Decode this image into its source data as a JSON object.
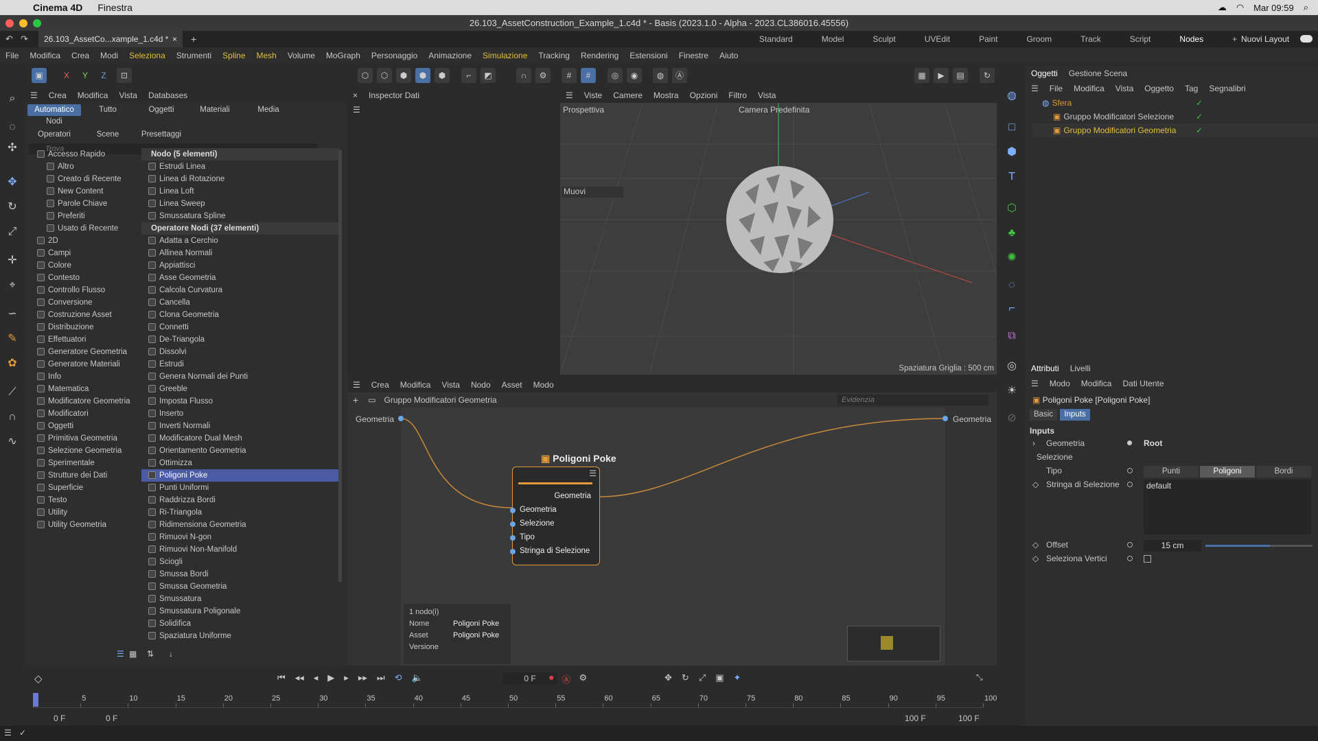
{
  "mac": {
    "app": "Cinema 4D",
    "menu1": "Finestra",
    "clock": "Mar 09:59"
  },
  "window": {
    "title": "26.103_AssetConstruction_Example_1.c4d * - Basis (2023.1.0 - Alpha - 2023.CL386016.45556)"
  },
  "doc_tab": {
    "label": "26.103_AssetCo...xample_1.c4d *",
    "close": "×",
    "add": "+"
  },
  "layouts": [
    "Standard",
    "Model",
    "Sculpt",
    "UVEdit",
    "Paint",
    "Groom",
    "Track",
    "Script",
    "Nodes",
    "+"
  ],
  "layout_new": "Nuovi Layout",
  "menu": [
    "File",
    "Modifica",
    "Crea",
    "Modi",
    "Seleziona",
    "Strumenti",
    "Spline",
    "Mesh",
    "Volume",
    "MoGraph",
    "Personaggio",
    "Animazione",
    "Simulazione",
    "Tracking",
    "Rendering",
    "Estensioni",
    "Finestre",
    "Aiuto"
  ],
  "axis": {
    "x": "X",
    "y": "Y",
    "z": "Z"
  },
  "asset_panel": {
    "header": [
      "Crea",
      "Modifica",
      "Vista",
      "Databases"
    ],
    "tabs_row1": [
      "Automatico",
      "Tutto",
      "Oggetti",
      "Materiali",
      "Media",
      "Nodi"
    ],
    "tabs_row2": [
      "Operatori",
      "Scene",
      "Presettaggi"
    ],
    "search_placeholder": "Trova",
    "tree": [
      "Accesso Rapido",
      "Altro",
      "Creato di Recente",
      "New Content",
      "Parole Chiave",
      "Preferiti",
      "Usato di Recente",
      "2D",
      "Campi",
      "Colore",
      "Contesto",
      "Controllo Flusso",
      "Conversione",
      "Costruzione Asset",
      "Distribuzione",
      "Effettuatori",
      "Generatore Geometria",
      "Generatore Materiali",
      "Info",
      "Matematica",
      "Modificatore Geometria",
      "Modificatori",
      "Oggetti",
      "Primitiva Geometria",
      "Selezione Geometria",
      "Sperimentale",
      "Strutture dei Dati",
      "Superficie",
      "Testo",
      "Utility",
      "Utility Geometria"
    ],
    "group1": "Nodo (5 elementi)",
    "group1_items": [
      "Estrudi Linea",
      "Linea di Rotazione",
      "Linea Loft",
      "Linea Sweep",
      "Smussatura Spline"
    ],
    "group2": "Operatore Nodi (37 elementi)",
    "group2_items": [
      "Adatta a Cerchio",
      "Allinea Normali",
      "Appiattisci",
      "Asse Geometria",
      "Calcola Curvatura",
      "Cancella",
      "Clona Geometria",
      "Connetti",
      "De-Triangola",
      "Dissolvi",
      "Estrudi",
      "Genera Normali dei Punti",
      "Greeble",
      "Imposta Flusso",
      "Inserto",
      "Inverti Normali",
      "Modificatore Dual Mesh",
      "Orientamento Geometria",
      "Ottimizza",
      "Poligoni Poke",
      "Punti Uniformi",
      "Raddrizza Bordi",
      "Ri-Triangola",
      "Ridimensiona Geometria",
      "Rimuovi N-gon",
      "Rimuovi Non-Manifold",
      "Sciogli",
      "Smussa Bordi",
      "Smussa Geometria",
      "Smussatura",
      "Smussatura Poligonale",
      "Solidifica",
      "Spaziatura Uniforme"
    ]
  },
  "inspector": {
    "title": "Inspector Dati"
  },
  "viewport": {
    "menu": [
      "Viste",
      "Camere",
      "Mostra",
      "Opzioni",
      "Filtro",
      "Vista"
    ],
    "view_name": "Prospettiva",
    "camera": "Camera Predefinita",
    "tool": "Muovi",
    "grid": "Spaziatura Griglia : 500 cm"
  },
  "node_editor": {
    "menu": [
      "Crea",
      "Modifica",
      "Vista",
      "Nodo",
      "Asset",
      "Modo"
    ],
    "breadcrumb": "Gruppo Modificatori Geometria",
    "search_placeholder": "Evidenzia",
    "left_port": "Geometria",
    "right_port": "Geometria",
    "node_title": "Poligoni Poke",
    "node_out": "Geometria",
    "node_inputs": [
      "Geometria",
      "Selezione",
      "Tipo",
      "Stringa di Selezione"
    ],
    "info": {
      "count": "1 nodo(i)",
      "name_k": "Nome",
      "name_v": "Poligoni Poke",
      "asset_k": "Asset",
      "asset_v": "Poligoni Poke",
      "ver_k": "Versione"
    }
  },
  "timeline": {
    "frame": "0 F",
    "ticks": [
      "0",
      "5",
      "10",
      "15",
      "20",
      "25",
      "30",
      "35",
      "40",
      "45",
      "50",
      "55",
      "60",
      "65",
      "70",
      "75",
      "80",
      "85",
      "90",
      "95",
      "100"
    ],
    "start": "0 F",
    "start2": "0 F",
    "end": "100 F",
    "end2": "100 F"
  },
  "objects": {
    "tabs": [
      "Oggetti",
      "Gestione Scena"
    ],
    "menu": [
      "File",
      "Modifica",
      "Vista",
      "Oggetto",
      "Tag",
      "Segnalibri"
    ],
    "items": [
      "Sfera",
      "Gruppo Modificatori Selezione",
      "Gruppo Modificatori Geometria"
    ]
  },
  "attributes": {
    "tabs": [
      "Attributi",
      "Livelli"
    ],
    "menu": [
      "Modo",
      "Modifica",
      "Dati Utente"
    ],
    "object": "Poligoni Poke [Poligoni Poke]",
    "subtabs": [
      "Basic",
      "Inputs"
    ],
    "section": "Inputs",
    "geometria_label": "Geometria",
    "geometria_value": "Root",
    "selezione_label": "Selezione",
    "tipo_label": "Tipo",
    "tipo_options": [
      "Punti",
      "Poligoni",
      "Bordi"
    ],
    "stringa_label": "Stringa di Selezione",
    "stringa_value": "default",
    "offset_label": "Offset",
    "offset_value": "15 cm",
    "offset_slider": 0.6,
    "vertici_label": "Seleziona Vertici"
  },
  "colors": {
    "accent": "#4a6fa5",
    "node_border": "#e39a3a",
    "wire": "#c98a3a",
    "check": "#3ec43e",
    "highlight": "#e0c13a"
  }
}
